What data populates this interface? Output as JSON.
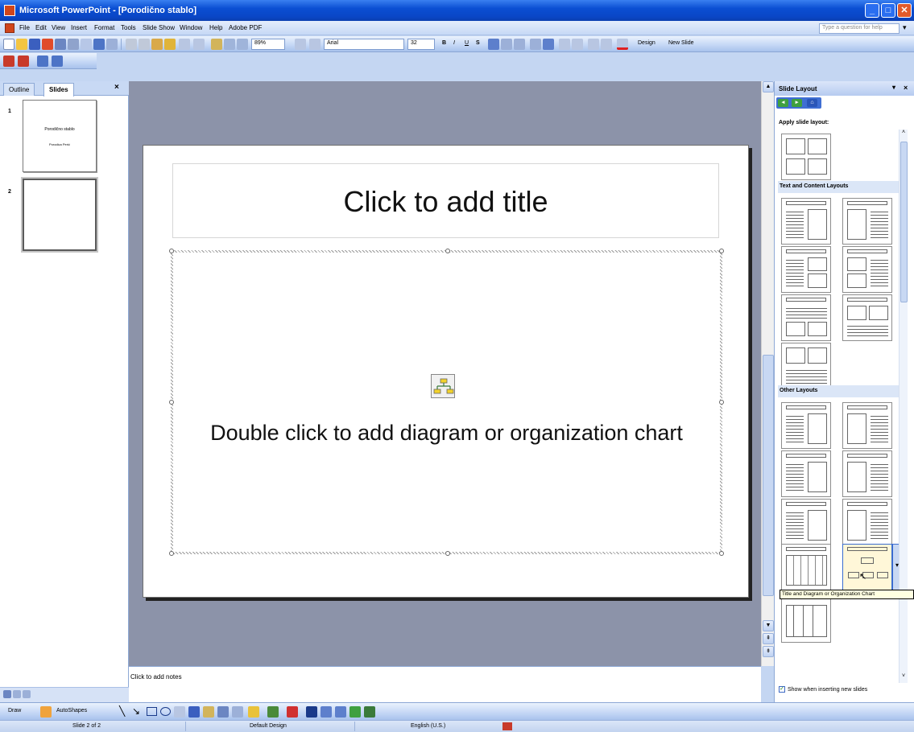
{
  "window": {
    "title": "Microsoft PowerPoint - [Porodično stablo]",
    "min_label": "_",
    "max_label": "□",
    "close_label": "✕"
  },
  "menubar": {
    "items": [
      "File",
      "Edit",
      "View",
      "Insert",
      "Format",
      "Tools",
      "Slide Show",
      "Window",
      "Help",
      "Adobe PDF"
    ],
    "ask_placeholder": "Type a question for help"
  },
  "toolbar": {
    "zoom": "89%",
    "font": "Arial",
    "font_size": "32",
    "bold": "B",
    "italic": "I",
    "underline": "U",
    "shadow": "S",
    "design_label": "Design",
    "new_slide_label": "New Slide"
  },
  "tabs": {
    "outline": "Outline",
    "slides": "Slides",
    "close": "×"
  },
  "thumbnails": [
    {
      "num": "1",
      "title": "Porodično stablo",
      "subtitle": "Porodica Perić"
    },
    {
      "num": "2",
      "title": "",
      "subtitle": ""
    }
  ],
  "slide": {
    "title_placeholder": "Click to add title",
    "content_placeholder": "Double click to add diagram or organization chart"
  },
  "notes": {
    "placeholder": "Click to add notes"
  },
  "taskpane": {
    "title": "Slide Layout",
    "apply_label": "Apply slide layout:",
    "section_text_content": "Text and Content Layouts",
    "section_other": "Other Layouts",
    "tooltip": "Title and Diagram or Organization Chart",
    "show_checkbox": "Show when inserting new slides"
  },
  "drawbar": {
    "draw_label": "Draw",
    "autoshapes_label": "AutoShapes"
  },
  "status": {
    "slide_info": "Slide 2 of 2",
    "design": "Default Design",
    "language": "English (U.S.)"
  },
  "colors": {
    "title_bar": "#0b4fd3",
    "slide_bg_area": "#8c93a9",
    "toolbar": "#c3d6f5",
    "panel_section": "#dbe6f7"
  }
}
